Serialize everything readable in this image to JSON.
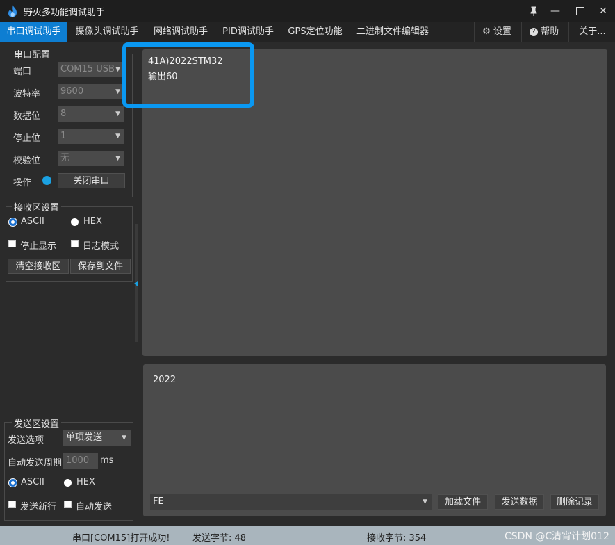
{
  "window": {
    "title": "野火多功能调试助手"
  },
  "tabs": [
    "串口调试助手",
    "摄像头调试助手",
    "网络调试助手",
    "PID调试助手",
    "GPS定位功能",
    "二进制文件编辑器"
  ],
  "right_tabs": {
    "settings": "设置",
    "help": "帮助",
    "about": "关于..."
  },
  "serial_config": {
    "title": "串口配置",
    "port_label": "端口",
    "port_value": "COM15 USB",
    "baud_label": "波特率",
    "baud_value": "9600",
    "databits_label": "数据位",
    "databits_value": "8",
    "stopbits_label": "停止位",
    "stopbits_value": "1",
    "parity_label": "校验位",
    "parity_value": "无",
    "operation_label": "操作",
    "close_port_button": "关闭串口"
  },
  "receive_settings": {
    "title": "接收区设置",
    "ascii": "ASCII",
    "hex": "HEX",
    "stop_display": "停止显示",
    "log_mode": "日志模式",
    "clear_button": "清空接收区",
    "save_button": "保存到文件"
  },
  "send_settings": {
    "title": "发送区设置",
    "send_option_label": "发送选项",
    "send_option_value": "单项发送",
    "auto_period_label": "自动发送周期",
    "auto_period_value": "1000",
    "auto_period_unit": "ms",
    "ascii": "ASCII",
    "hex": "HEX",
    "send_newline": "发送新行",
    "auto_send": "自动发送"
  },
  "receive_area": {
    "line1": "41A)2022STM32",
    "line2": "输出60"
  },
  "send_area": {
    "text": "2022",
    "history_value": "FE",
    "load_file_button": "加载文件",
    "send_data_button": "发送数据",
    "delete_record_button": "删除记录"
  },
  "status": {
    "port_msg": "串口[COM15]打开成功!",
    "sent_bytes": "发送字节: 48",
    "received_bytes": "接收字节: 354",
    "watermark": "CSDN @C清宵计划012"
  },
  "colors": {
    "accent": "#0e7ed2",
    "highlight_box": "#0a98f2",
    "status_indicator": "#1ba1e2"
  }
}
